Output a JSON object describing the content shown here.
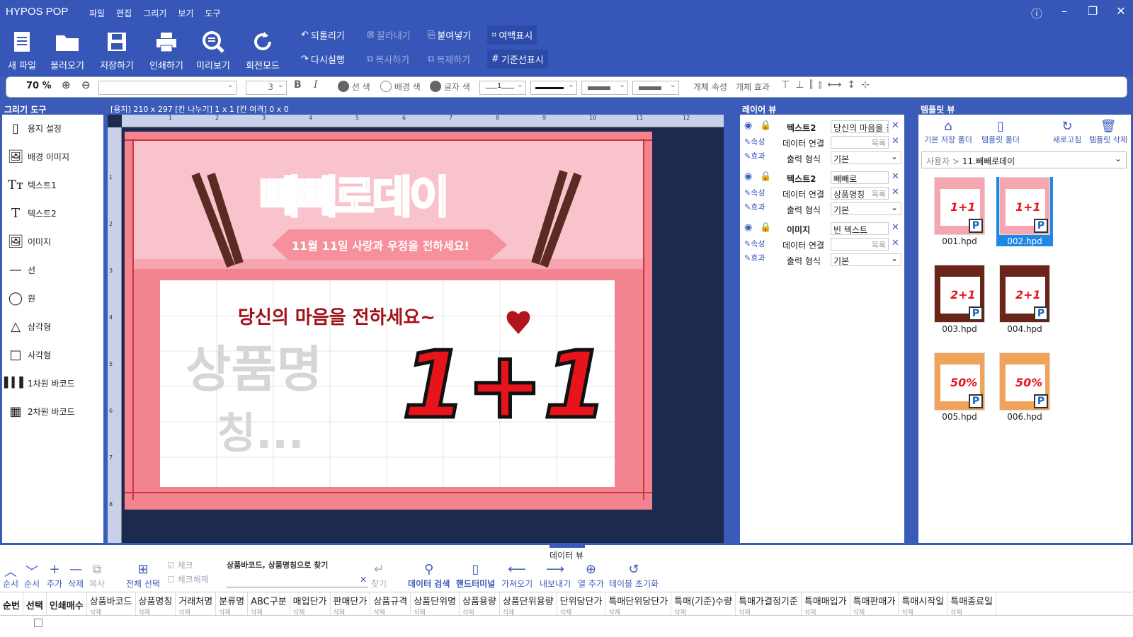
{
  "app_title": "HYPOS POP",
  "menus": [
    "파일",
    "편집",
    "그리기",
    "보기",
    "도구"
  ],
  "ribbon": {
    "new": "새 파일",
    "open": "불러오기",
    "save": "저장하기",
    "print": "인쇄하기",
    "preview": "미리보기",
    "rotate": "회전모드",
    "undo": "되돌리기",
    "redo": "다시실행",
    "cut": "잘라내기",
    "copy": "복사하기",
    "paste": "붙여넣기",
    "duplicate": "복제하기",
    "margin": "여백표시",
    "guide": "기준선표시"
  },
  "format": {
    "zoom": "70 %",
    "font_size": "3",
    "bold": "B",
    "italic": "I",
    "line_color": "선 색",
    "bg_color": "배경 색",
    "text_color": "글자 색",
    "line_width": "1",
    "obj_props": "개체 속성",
    "obj_effects": "개체 효과"
  },
  "panels": {
    "tools": "그리기 도구",
    "canvas_info": "[용지] 210 x 297  [칸 나누기] 1 x 1  [칸 여격] 0 x 0",
    "layer": "레이어 뷰",
    "template": "템플릿 뷰",
    "data": "데이터 뷰"
  },
  "tools": [
    "용지 설정",
    "배경 이미지",
    "텍스트1",
    "텍스트2",
    "이미지",
    "선",
    "원",
    "삼각형",
    "사각형",
    "1차원 바코드",
    "2차원 바코드"
  ],
  "ruler": {
    "unit": "px",
    "h": [
      "1",
      "2",
      "3",
      "4",
      "5",
      "6",
      "7",
      "8",
      "9",
      "10",
      "11",
      "12"
    ],
    "v": [
      "1",
      "2",
      "3",
      "4",
      "5",
      "6",
      "7",
      "8"
    ]
  },
  "poster": {
    "title_a": "빼빼로",
    "title_b": "데이",
    "subtitle": "11월 11일 사랑과 우정을 전하세요!",
    "message": "당신의 마음을 전하세요~",
    "product": "상품명",
    "product2": "칭...",
    "promo": "1+1"
  },
  "layers": [
    {
      "type": "텍스트2",
      "value": "당신의 마음을 전ㅎ",
      "link_label": "데이터 연결",
      "link": "",
      "list": "목록",
      "fmt_label": "출력 형식",
      "fmt": "기본",
      "prop": "속성",
      "eff": "효과"
    },
    {
      "type": "텍스트2",
      "value": "빼빼로",
      "link_label": "데이터 연결",
      "link": "상품명칭",
      "list": "목록",
      "fmt_label": "출력 형식",
      "fmt": "기본",
      "prop": "속성",
      "eff": "효과"
    },
    {
      "type": "이미지",
      "value": "빈 텍스트",
      "link_label": "데이터 연결",
      "link": "",
      "list": "목록",
      "fmt_label": "출력 형식",
      "fmt": "기본",
      "prop": "속성",
      "eff": "효과"
    }
  ],
  "template": {
    "home": "기본 저장 폴더",
    "folder": "템플릿 폴더",
    "refresh": "새로고침",
    "delete": "템플릿 삭제",
    "path_root": "사용자",
    "path_sep": ">",
    "path": "11.빼빼로데이",
    "items": [
      {
        "file": "001.hpd",
        "label": "1+1"
      },
      {
        "file": "002.hpd",
        "label": "1+1"
      },
      {
        "file": "003.hpd",
        "label": "2+1"
      },
      {
        "file": "004.hpd",
        "label": "2+1"
      },
      {
        "file": "005.hpd",
        "label": "50%"
      },
      {
        "file": "006.hpd",
        "label": "50%"
      }
    ]
  },
  "dataview": {
    "up": "순서",
    "down": "순서",
    "add": "추가",
    "del": "삭제",
    "copy": "복사",
    "select_all": "전체 선택",
    "check": "체크",
    "uncheck": "체크해제",
    "search_label": "상품바코드, 상품명칭으로 찾기",
    "find": "찾기",
    "data_search": "데이터 검색",
    "handheld": "핸드터미널",
    "import": "가져오기",
    "export": "내보내기",
    "add_col": "열 추가",
    "reset": "테이블 초기화"
  },
  "columns": [
    {
      "n": "순번",
      "d": ""
    },
    {
      "n": "선택",
      "d": ""
    },
    {
      "n": "인쇄매수",
      "d": ""
    },
    {
      "n": "상품바코드",
      "d": "삭제"
    },
    {
      "n": "상품명칭",
      "d": "삭제"
    },
    {
      "n": "거래처명",
      "d": "삭제"
    },
    {
      "n": "분류명",
      "d": "삭제"
    },
    {
      "n": "ABC구분",
      "d": "삭제"
    },
    {
      "n": "매입단가",
      "d": "삭제"
    },
    {
      "n": "판매단가",
      "d": "삭제"
    },
    {
      "n": "상품규격",
      "d": "삭제"
    },
    {
      "n": "상품단위명",
      "d": "삭제"
    },
    {
      "n": "상품용량",
      "d": "삭제"
    },
    {
      "n": "상품단위용량",
      "d": "삭제"
    },
    {
      "n": "단위당단가",
      "d": "삭제"
    },
    {
      "n": "특매단위당단가",
      "d": "삭제"
    },
    {
      "n": "특매(기준)수량",
      "d": "삭제"
    },
    {
      "n": "특매가결정기준",
      "d": "삭제"
    },
    {
      "n": "특매매입가",
      "d": "삭제"
    },
    {
      "n": "특매판매가",
      "d": "삭제"
    },
    {
      "n": "특매시작일",
      "d": "삭제"
    },
    {
      "n": "특매종료일",
      "d": "삭제"
    }
  ],
  "colors": {
    "accent": "#3656b8",
    "poster_pink": "#f3838f",
    "promo_red": "#e8141c"
  }
}
